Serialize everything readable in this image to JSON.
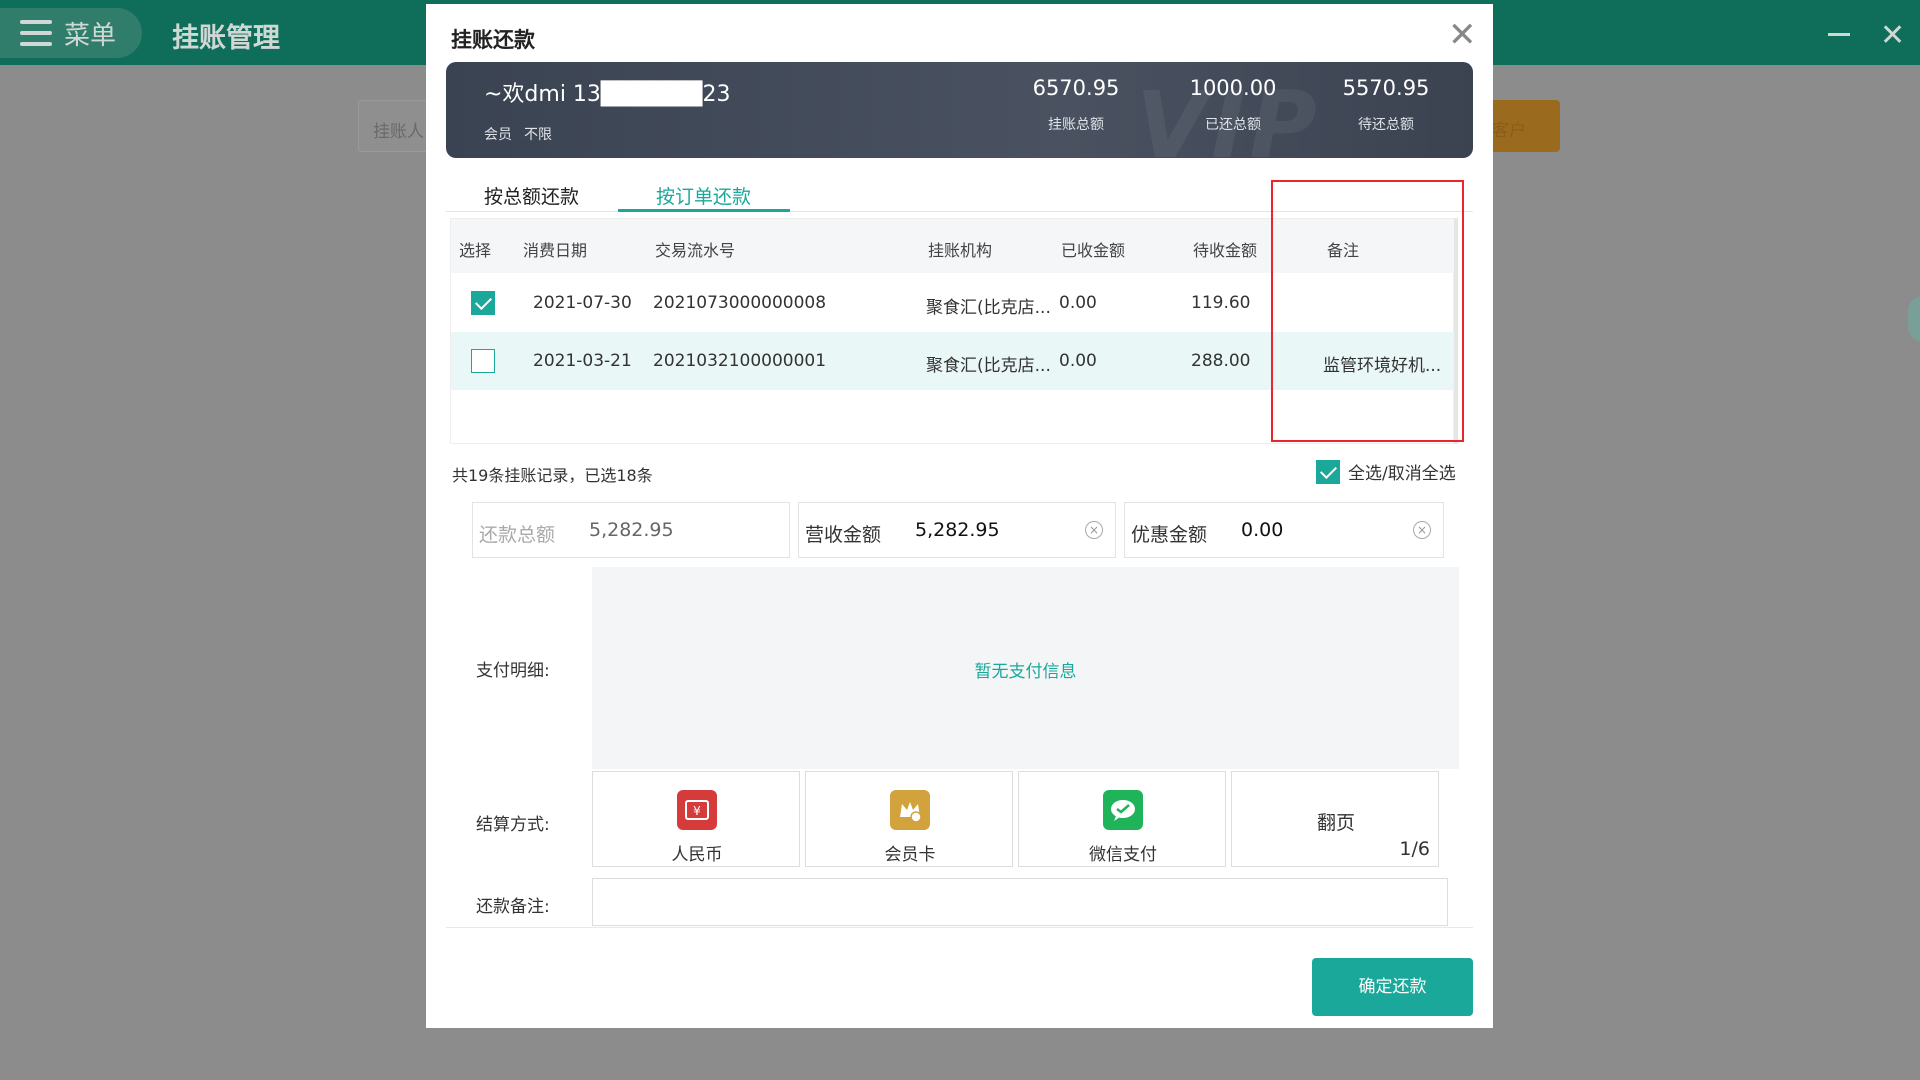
{
  "app": {
    "menu_label": "菜单",
    "title": "挂账管理",
    "search_placeholder": "挂账人",
    "add_customer_label": "客户"
  },
  "modal": {
    "title": "挂账还款",
    "member": {
      "name": "~欢dmi 13██████23",
      "level_label": "会员",
      "level_value": "不限",
      "watermark": "VIP"
    },
    "stats": [
      {
        "value": "6570.95",
        "label": "挂账总额"
      },
      {
        "value": "1000.00",
        "label": "已还总额"
      },
      {
        "value": "5570.95",
        "label": "待还总额"
      }
    ],
    "tabs": [
      {
        "label": "按总额还款",
        "active": false
      },
      {
        "label": "按订单还款",
        "active": true
      }
    ],
    "table": {
      "columns": [
        "选择",
        "消费日期",
        "交易流水号",
        "挂账机构",
        "已收金额",
        "待收金额",
        "备注"
      ],
      "rows": [
        {
          "checked": true,
          "date": "2021-07-30",
          "serial": "2021073000000008",
          "org": "聚食汇(比克店...",
          "received": "0.00",
          "pending": "119.60",
          "note": ""
        },
        {
          "checked": false,
          "date": "2021-03-21",
          "serial": "2021032100000001",
          "org": "聚食汇(比克店...",
          "received": "0.00",
          "pending": "288.00",
          "note": "监管环境好机..."
        }
      ]
    },
    "summary": "共19条挂账记录，已选18条",
    "select_all_label": "全选/取消全选",
    "amounts": [
      {
        "label": "还款总额",
        "value": "5,282.95"
      },
      {
        "label": "营收金额",
        "value": "5,282.95"
      },
      {
        "label": "优惠金额",
        "value": "0.00"
      }
    ],
    "pay_detail_label": "支付明细:",
    "pay_empty_text": "暂无支付信息",
    "settle_label": "结算方式:",
    "methods": [
      {
        "label": "人民币",
        "icon": "rmb-icon",
        "color": "#d63b3b"
      },
      {
        "label": "会员卡",
        "icon": "member-card-icon",
        "color": "#d2a23c"
      },
      {
        "label": "微信支付",
        "icon": "wechat-icon",
        "color": "#1fb35a"
      }
    ],
    "flip": {
      "label": "翻页",
      "page": "1/6"
    },
    "note_label": "还款备注:",
    "note_value": "",
    "confirm_label": "确定还款"
  },
  "colors": {
    "accent": "#1aa89a",
    "topbar": "#0f6e5a",
    "highlight_box": "#e8262b"
  }
}
